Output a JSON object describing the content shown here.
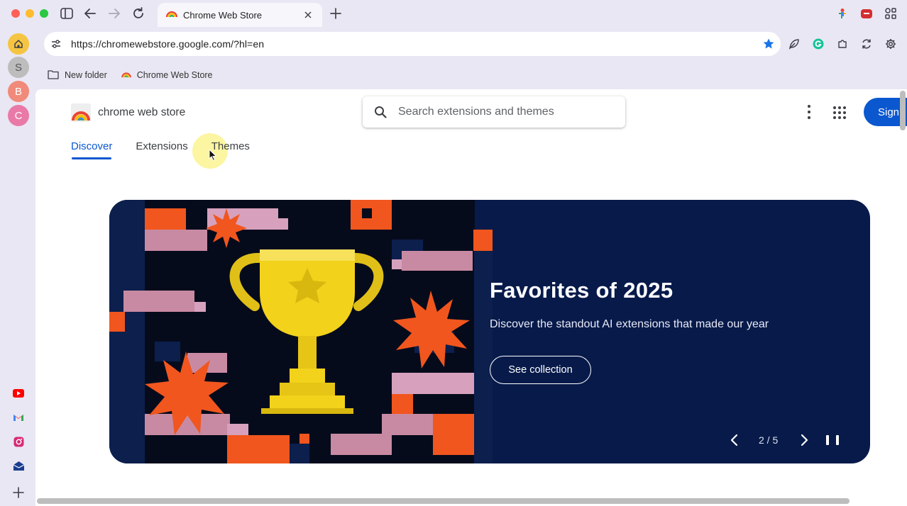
{
  "tab": {
    "title": "Chrome Web Store"
  },
  "omnibox": {
    "url": "https://chromewebstore.google.com/?hl=en"
  },
  "bookmarks": [
    {
      "label": "New folder",
      "icon": "folder-icon"
    },
    {
      "label": "Chrome Web Store",
      "icon": "rainbow-icon"
    }
  ],
  "sidebar": {
    "avatars": [
      "S",
      "B",
      "C"
    ],
    "apps": [
      "youtube-icon",
      "gmail-icon",
      "instagram-icon",
      "mail-icon"
    ]
  },
  "store": {
    "name": "chrome web store",
    "search_placeholder": "Search extensions and themes",
    "signin_label": "Sign",
    "nav": [
      "Discover",
      "Extensions",
      "Themes"
    ]
  },
  "hero": {
    "title": "Favorites of 2025",
    "subtitle": "Discover the standout AI extensions that made our year",
    "button": "See collection",
    "counter": "2 / 5"
  },
  "colors": {
    "accent": "#0b57d0",
    "hero_bg": "#071a4a",
    "orange": "#f0561e",
    "gold": "#f2d21b"
  }
}
